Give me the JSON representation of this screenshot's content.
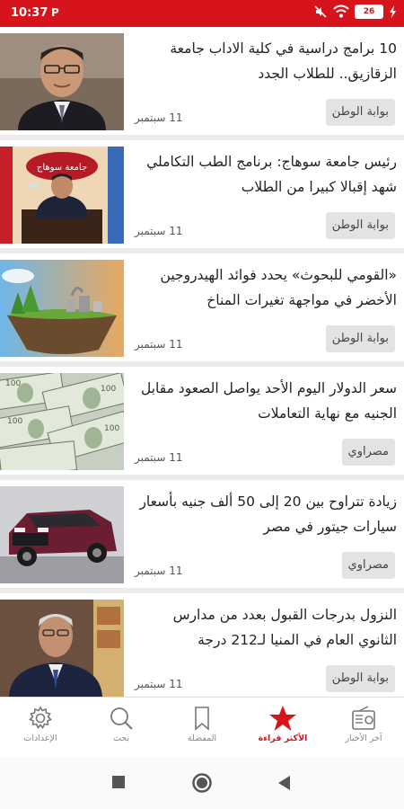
{
  "status": {
    "time": "10:37",
    "app_glyph": "P",
    "battery": "26"
  },
  "articles": [
    {
      "headline": "10 برامج دراسية في كلية الاداب جامعة الزقازيق.. للطلاب الجدد",
      "source": "بوابة الوطن",
      "date": "11 سبتمبر",
      "image": "man-portrait"
    },
    {
      "headline": "رئيس جامعة سوهاج: برنامج الطب التكاملي شهد إقبالا كبيرا من الطلاب",
      "source": "بوابة الوطن",
      "date": "11 سبتمبر",
      "image": "official-at-desk"
    },
    {
      "headline": "«القومي للبحوث» يحدد فوائد الهيدروجين الأخضر في مواجهة تغيرات المناخ",
      "source": "بوابة الوطن",
      "date": "11 سبتمبر",
      "image": "floating-island"
    },
    {
      "headline": "سعر الدولار اليوم الأحد يواصل الصعود مقابل الجنيه مع نهاية التعاملات",
      "source": "مصراوي",
      "date": "11 سبتمبر",
      "image": "dollar-bills"
    },
    {
      "headline": "زيادة تتراوح بين 20 إلى 50 ألف جنيه بأسعار سيارات جيتور في مصر",
      "source": "مصراوي",
      "date": "11 سبتمبر",
      "image": "red-suv"
    },
    {
      "headline": "النزول بدرجات القبول بعدد من مدارس الثانوي العام في المنيا لـ212 درجة",
      "source": "بوابة الوطن",
      "date": "11 سبتمبر",
      "image": "governor-portrait"
    }
  ],
  "nav": [
    {
      "label": "الإعدادات",
      "icon": "gear-icon"
    },
    {
      "label": "بحث",
      "icon": "search-icon"
    },
    {
      "label": "المفضلة",
      "icon": "bookmark-icon"
    },
    {
      "label": "الأكثر قراءة",
      "icon": "star-icon",
      "active": true
    },
    {
      "label": "آخر الأخبار",
      "icon": "radio-icon"
    }
  ],
  "colors": {
    "brand": "#d7141c",
    "background": "#ececec"
  }
}
